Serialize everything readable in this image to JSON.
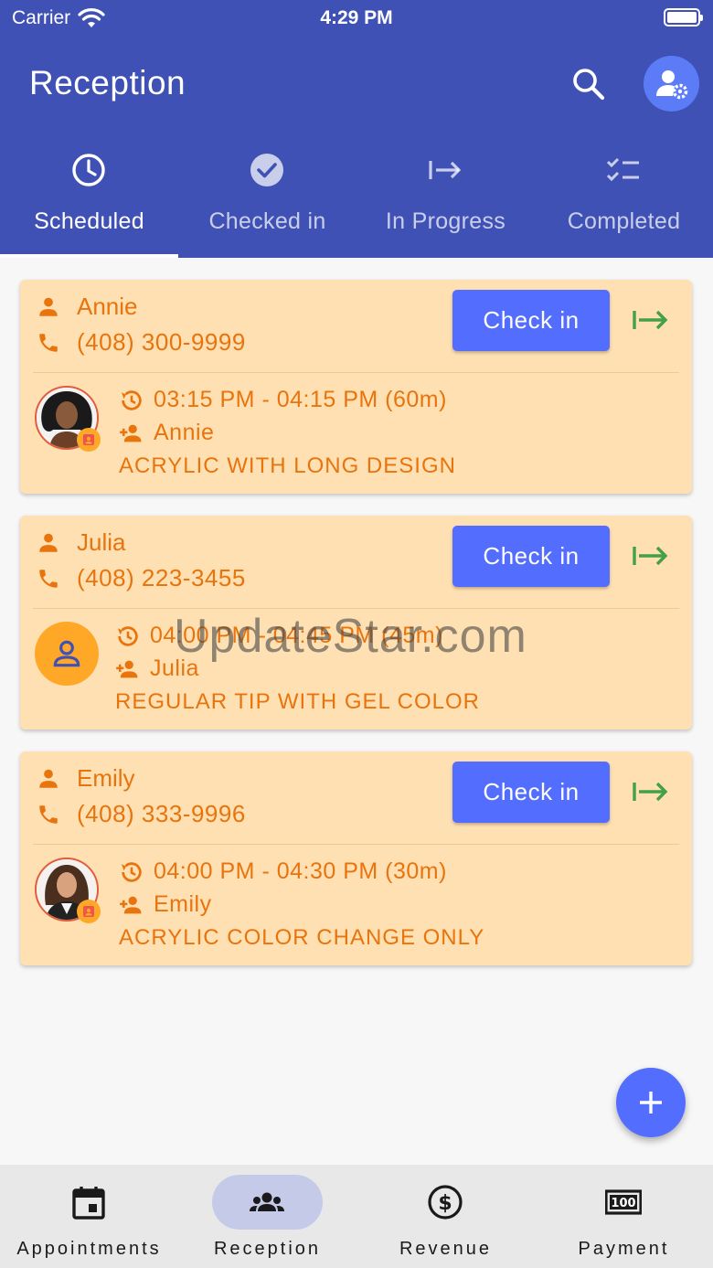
{
  "status_bar": {
    "carrier": "Carrier",
    "time": "4:29 PM"
  },
  "app_bar": {
    "title": "Reception"
  },
  "tabs": [
    {
      "label": "Scheduled",
      "icon": "clock-icon",
      "active": true
    },
    {
      "label": "Checked in",
      "icon": "check-circle-icon",
      "active": false
    },
    {
      "label": "In Progress",
      "icon": "arrow-right-to-line-icon",
      "active": false
    },
    {
      "label": "Completed",
      "icon": "checklist-icon",
      "active": false
    }
  ],
  "appointments": [
    {
      "customer": "Annie",
      "phone": "(408) 300-9999",
      "time": "03:15 PM - 04:15 PM (60m)",
      "staff": "Annie",
      "service": "ACRYLIC WITH LONG DESIGN",
      "action_label": "Check in",
      "avatar": "photo"
    },
    {
      "customer": "Julia",
      "phone": "(408) 223-3455",
      "time": "04:00 PM - 04:45 PM (45m)",
      "staff": "Julia",
      "service": "REGULAR TIP WITH GEL COLOR",
      "action_label": "Check in",
      "avatar": "placeholder"
    },
    {
      "customer": "Emily",
      "phone": "(408) 333-9996",
      "time": "04:00 PM - 04:30 PM (30m)",
      "staff": "Emily",
      "service": "ACRYLIC COLOR CHANGE ONLY",
      "action_label": "Check in",
      "avatar": "photo"
    }
  ],
  "watermark": "UpdateStar.com",
  "bottom_nav": [
    {
      "label": "Appointments",
      "icon": "calendar-icon",
      "active": false
    },
    {
      "label": "Reception",
      "icon": "group-icon",
      "active": true
    },
    {
      "label": "Revenue",
      "icon": "dollar-circle-icon",
      "active": false
    },
    {
      "label": "Payment",
      "icon": "cash-icon",
      "active": false
    }
  ],
  "colors": {
    "primary": "#3f51b5",
    "accent": "#536dfe",
    "card": "#ffe0b2",
    "orange_text": "#e8740e",
    "green_action": "#43a047"
  }
}
